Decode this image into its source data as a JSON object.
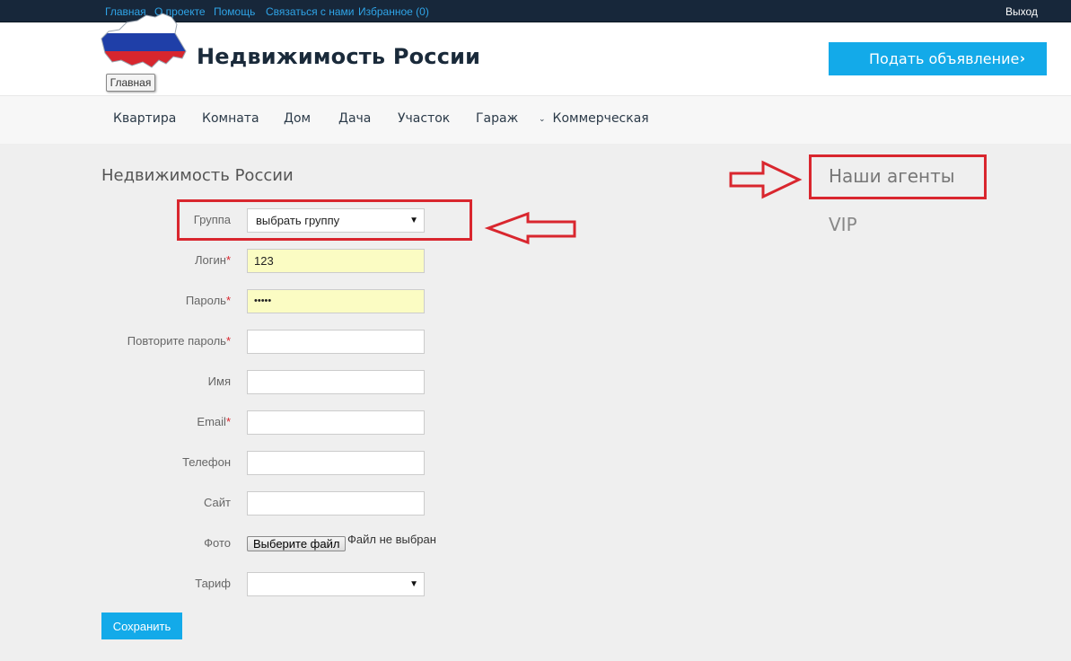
{
  "topbar": {
    "links": [
      "Главная",
      "О проекте",
      "Помощь",
      "Связаться с нами",
      "Избранное (0)"
    ],
    "logout": "Выход"
  },
  "header": {
    "home_badge": "Главная",
    "site_title": "Недвижимость России",
    "post_ad_label": "Подать объявление",
    "post_ad_chevron": "›"
  },
  "nav": {
    "items": [
      "Квартира",
      "Комната",
      "Дом",
      "Дача",
      "Участок",
      "Гараж"
    ],
    "dropdown_item": "Коммерческая",
    "dropdown_caret": "⌄"
  },
  "form": {
    "heading": "Недвижимость России",
    "group": {
      "label": "Группа",
      "value": "выбрать группу"
    },
    "login": {
      "label": "Логин",
      "required": "*",
      "value": "123"
    },
    "password": {
      "label": "Пароль",
      "required": "*",
      "value": "•••••"
    },
    "repeat_password": {
      "label": "Повторите пароль",
      "required": "*",
      "value": ""
    },
    "name": {
      "label": "Имя",
      "value": ""
    },
    "email": {
      "label": "Email",
      "required": "*",
      "value": ""
    },
    "phone": {
      "label": "Телефон",
      "value": ""
    },
    "site": {
      "label": "Сайт",
      "value": ""
    },
    "photo": {
      "label": "Фото",
      "button": "Выберите файл",
      "status": "Файл не выбран"
    },
    "tariff": {
      "label": "Тариф",
      "value": ""
    },
    "select_arrow": "▼",
    "save_label": "Сохранить"
  },
  "sidebar": {
    "agents_title": "Наши агенты",
    "vip_title": "VIP"
  },
  "colors": {
    "accent": "#13aae9",
    "topbar_bg": "#17273a",
    "link": "#2fa4e7",
    "annotation": "#d9262e",
    "autofill": "#fbfcc3"
  }
}
